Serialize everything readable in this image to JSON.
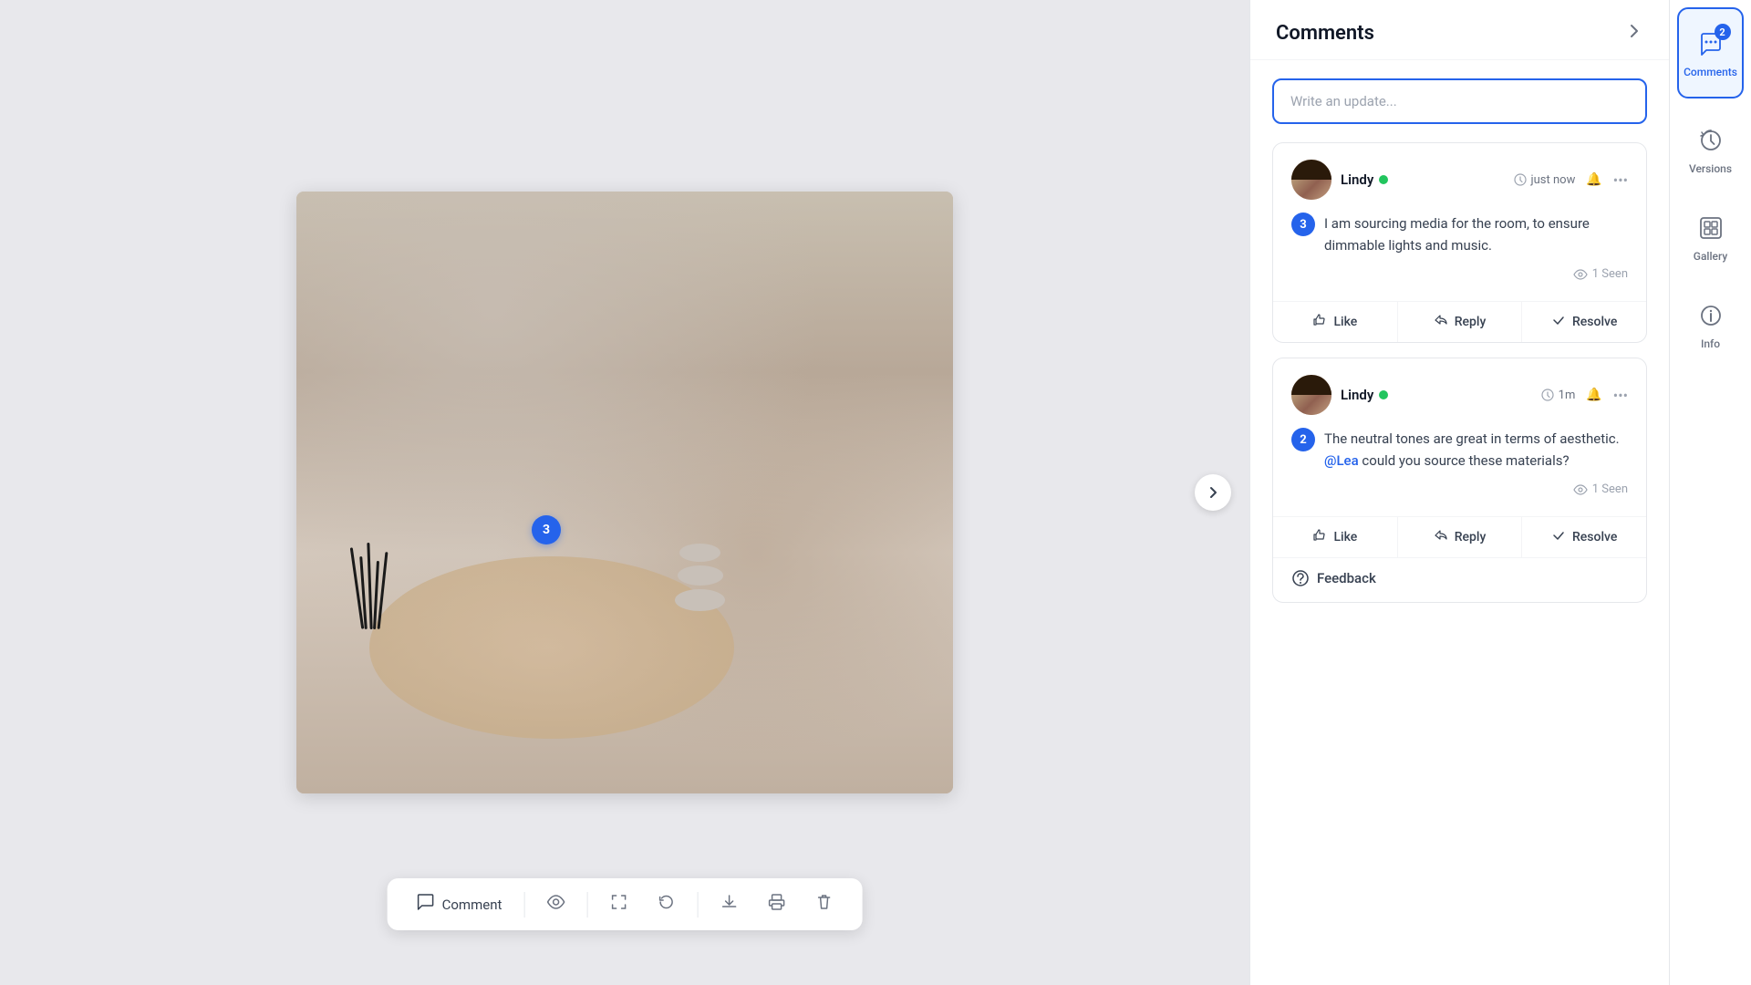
{
  "header": {
    "comments_title": "Comments",
    "arrow_label": "›"
  },
  "write_update": {
    "placeholder": "Write an update..."
  },
  "comments": [
    {
      "id": 1,
      "user": "Lindy",
      "online": true,
      "time": "just now",
      "number": 3,
      "text": "I am sourcing media for the room, to ensure dimmable lights and music.",
      "seen_count": "1 Seen",
      "actions": [
        "Like",
        "Reply",
        "Resolve"
      ]
    },
    {
      "id": 2,
      "user": "Lindy",
      "online": true,
      "time": "1m",
      "number": 2,
      "text": "The neutral tones are great in terms of aesthetic. @Lea could you source these materials?",
      "seen_count": "1 Seen",
      "actions": [
        "Like",
        "Reply",
        "Resolve"
      ],
      "feedback": "Feedback"
    }
  ],
  "toolbar": {
    "comment_label": "Comment",
    "items": [
      "Comment",
      "eye",
      "expand",
      "refresh",
      "download",
      "print",
      "trash"
    ]
  },
  "sidebar": {
    "items": [
      {
        "id": "comments",
        "label": "Comments",
        "badge": "2",
        "active": true
      },
      {
        "id": "versions",
        "label": "Versions",
        "active": false
      },
      {
        "id": "gallery",
        "label": "Gallery",
        "active": false
      },
      {
        "id": "info",
        "label": "Info",
        "active": false
      }
    ]
  },
  "image": {
    "badge_number": "3"
  },
  "colors": {
    "accent": "#2563eb",
    "online": "#22c55e",
    "text_primary": "#111827",
    "text_secondary": "#6b7280"
  }
}
